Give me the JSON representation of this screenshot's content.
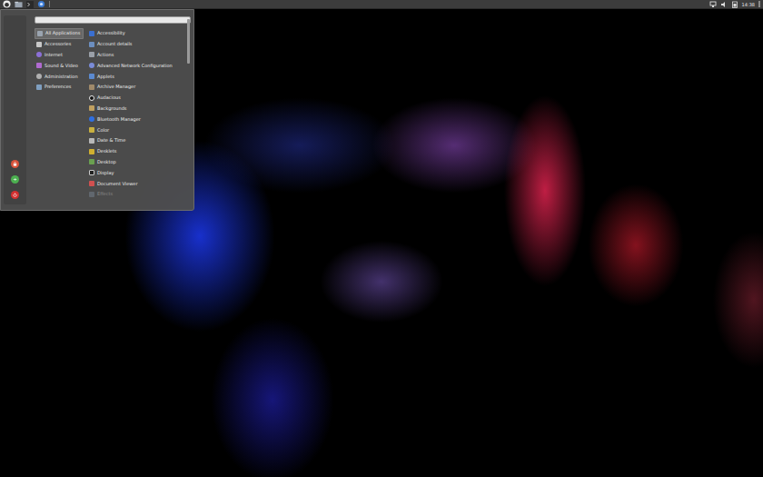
{
  "top_panel": {
    "clock": "14:38"
  },
  "menu": {
    "categories": [
      {
        "label": "All Applications",
        "selected": true
      },
      {
        "label": "Accessories",
        "selected": false
      },
      {
        "label": "Internet",
        "selected": false
      },
      {
        "label": "Sound & Video",
        "selected": false
      },
      {
        "label": "Administration",
        "selected": false
      },
      {
        "label": "Preferences",
        "selected": false
      }
    ],
    "apps": [
      {
        "label": "Accessibility",
        "faded": false
      },
      {
        "label": "Account details",
        "faded": false
      },
      {
        "label": "Actions",
        "faded": false
      },
      {
        "label": "Advanced Network Configuration",
        "faded": false
      },
      {
        "label": "Applets",
        "faded": false
      },
      {
        "label": "Archive Manager",
        "faded": false
      },
      {
        "label": "Audacious",
        "faded": false
      },
      {
        "label": "Backgrounds",
        "faded": false
      },
      {
        "label": "Bluetooth Manager",
        "faded": false
      },
      {
        "label": "Color",
        "faded": false
      },
      {
        "label": "Date & Time",
        "faded": false
      },
      {
        "label": "Desklets",
        "faded": false
      },
      {
        "label": "Desktop",
        "faded": false
      },
      {
        "label": "Display",
        "faded": false
      },
      {
        "label": "Document Viewer",
        "faded": false
      },
      {
        "label": "Effects",
        "faded": true
      }
    ],
    "scrollbar": {
      "level": 0.24
    },
    "session_buttons": [
      {
        "kind": "lock",
        "color": "#d9533b"
      },
      {
        "kind": "logout",
        "color": "#4caf50"
      },
      {
        "kind": "shutdown",
        "color": "#d32f2f"
      }
    ]
  }
}
